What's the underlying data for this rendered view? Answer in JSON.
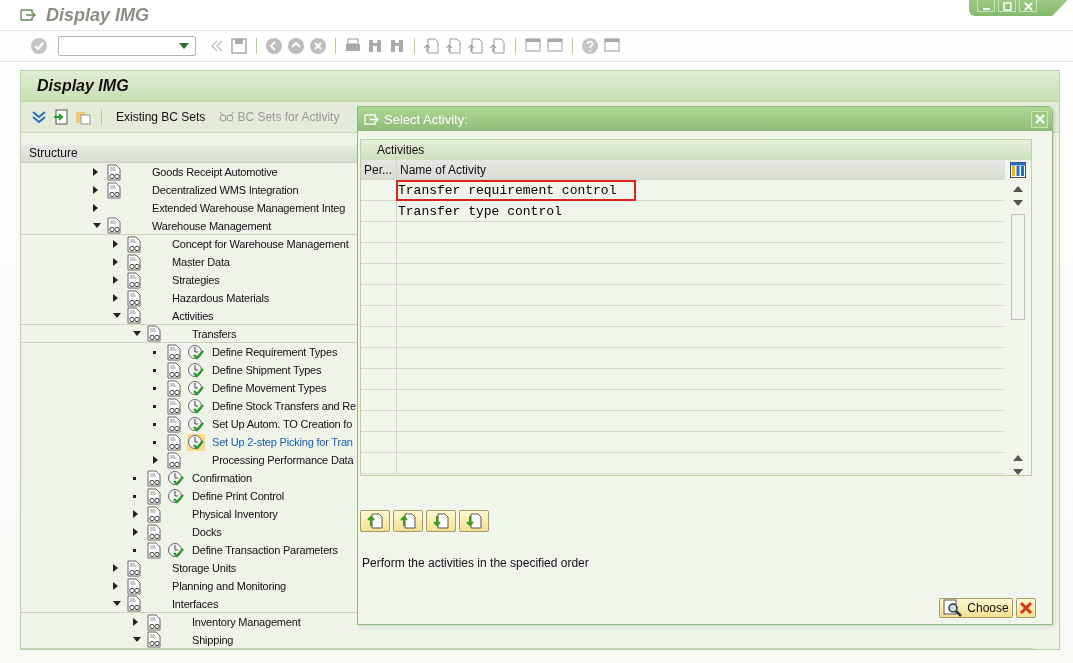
{
  "window": {
    "title": "Display IMG"
  },
  "screen": {
    "title": "Display IMG"
  },
  "app_toolbar": [
    {
      "label": "Existing BC Sets",
      "disabled": false
    },
    {
      "label": "BC Sets for Activity",
      "disabled": true
    }
  ],
  "tree": {
    "header": "Structure",
    "items": [
      {
        "kind": "folder",
        "label": "Goods Receipt Automotive",
        "expanded": false,
        "selected": false
      },
      {
        "kind": "folder",
        "label": "Decentralized WMS Integration",
        "expanded": false,
        "selected": false
      },
      {
        "kind": "node",
        "label": "Extended Warehouse Management Integ",
        "expanded": false,
        "selected": false
      },
      {
        "kind": "folder",
        "label": "Warehouse Management",
        "expanded": true,
        "selected": false,
        "children": [
          {
            "kind": "folder",
            "label": "Concept for Warehouse Management",
            "expanded": false,
            "selected": false
          },
          {
            "kind": "folder",
            "label": "Master Data",
            "expanded": false,
            "selected": false
          },
          {
            "kind": "folder",
            "label": "Strategies",
            "expanded": false,
            "selected": false
          },
          {
            "kind": "folder",
            "label": "Hazardous Materials",
            "expanded": false,
            "selected": false
          },
          {
            "kind": "folder",
            "label": "Activities",
            "expanded": true,
            "selected": false,
            "children": [
              {
                "kind": "folder",
                "label": "Transfers",
                "expanded": true,
                "selected": false,
                "children": [
                  {
                    "kind": "activity",
                    "label": "Define Requirement Types",
                    "selected": false
                  },
                  {
                    "kind": "activity",
                    "label": "Define Shipment Types",
                    "selected": false
                  },
                  {
                    "kind": "activity",
                    "label": "Define Movement Types",
                    "selected": false
                  },
                  {
                    "kind": "activity",
                    "label": "Define Stock Transfers and Re",
                    "selected": false
                  },
                  {
                    "kind": "activity",
                    "label": "Set Up Autom. TO Creation fo",
                    "selected": false
                  },
                  {
                    "kind": "activity",
                    "label": "Set Up 2-step Picking for Tran",
                    "selected": true
                  },
                  {
                    "kind": "folder",
                    "label": "Processing Performance Data",
                    "expanded": false,
                    "selected": false
                  }
                ]
              },
              {
                "kind": "activity",
                "label": "Confirmation",
                "selected": false
              },
              {
                "kind": "activity",
                "label": "Define Print Control",
                "selected": false
              },
              {
                "kind": "folder",
                "label": "Physical Inventory",
                "expanded": false,
                "selected": false
              },
              {
                "kind": "folder",
                "label": "Docks",
                "expanded": false,
                "selected": false
              },
              {
                "kind": "activity",
                "label": "Define Transaction Parameters",
                "selected": false
              }
            ]
          },
          {
            "kind": "folder",
            "label": "Storage Units",
            "expanded": false,
            "selected": false
          },
          {
            "kind": "folder",
            "label": "Planning and Monitoring",
            "expanded": false,
            "selected": false
          },
          {
            "kind": "folder",
            "label": "Interfaces",
            "expanded": true,
            "selected": false,
            "children": [
              {
                "kind": "folder",
                "label": "Inventory Management",
                "expanded": false,
                "selected": false
              },
              {
                "kind": "folder",
                "label": "Shipping",
                "expanded": true,
                "selected": false
              }
            ]
          }
        ]
      }
    ]
  },
  "dialog": {
    "title": "Select Activity:",
    "group_title": "Activities",
    "columns": [
      "Per...",
      "Name of Activity"
    ],
    "rows": [
      {
        "name": "Transfer requirement control",
        "selected": true
      },
      {
        "name": "Transfer type control",
        "selected": false
      }
    ],
    "hint": "Perform the activities in the specified order",
    "choose_label": "Choose"
  }
}
